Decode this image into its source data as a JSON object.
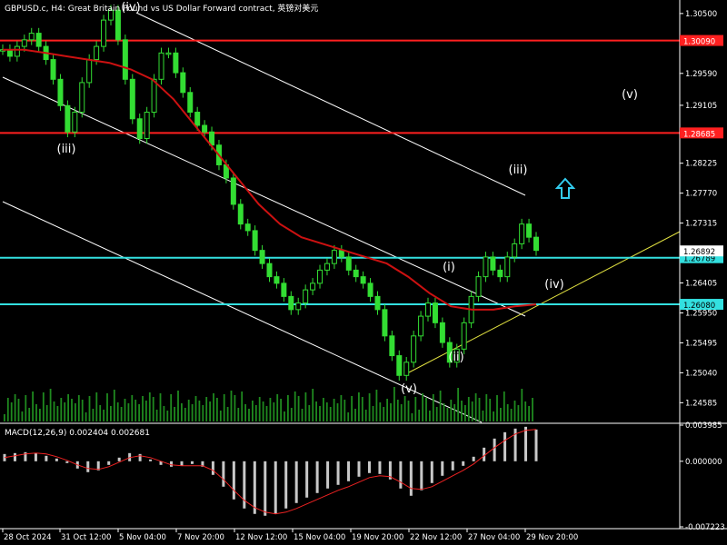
{
  "header": {
    "title": "GBPUSD.c, H4:  Great Britain Pound vs US Dollar Forward contract, 英镑对美元"
  },
  "colors": {
    "bg": "#000000",
    "candle": "#33dd33",
    "price_axis": "#ffffff",
    "support": "#ff2020",
    "cyan": "#33e0e0",
    "ma": "#cc1111",
    "channel": "#ffffff",
    "trend": "#e0e040",
    "macd_hist": "#c8c8c8",
    "signal": "#ee2222",
    "arrow": "#33ccee"
  },
  "icons": {
    "arrow": "up-arrow-icon"
  },
  "chart_data": [
    {
      "type": "line",
      "title": "GBPUSD.c, H4:  Great Britain Pound vs US Dollar Forward contract, 英镑对美元",
      "ylim": [
        1.243,
        1.3065
      ],
      "y_ticks": [
        "1.30500",
        "1.29590",
        "1.29105",
        "1.28225",
        "1.27770",
        "1.27315",
        "1.26405",
        "1.25950",
        "1.25495",
        "1.25040",
        "1.24585"
      ],
      "x_ticks": [
        "28 Oct 2024",
        "31 Oct 12:00",
        "5 Nov 04:00",
        "7 Nov 20:00",
        "12 Nov 12:00",
        "15 Nov 04:00",
        "19 Nov 20:00",
        "22 Nov 12:00",
        "27 Nov 04:00",
        "29 Nov 20:00"
      ],
      "horizontal_levels": [
        {
          "value": 1.3009,
          "label": "1.30090",
          "color": "#ff2020"
        },
        {
          "value": 1.28685,
          "label": "1.28685",
          "color": "#ff2020"
        },
        {
          "value": 1.26789,
          "label": "1.26789",
          "color": "#33e0e0"
        },
        {
          "value": 1.2608,
          "label": "1.26080",
          "color": "#33e0e0"
        }
      ],
      "current_price": "1.26892",
      "wave_labels": [
        "(iii)",
        "(iv)",
        "(v)",
        "(i)",
        "(ii)",
        "(iii)",
        "(iv)",
        "(v)"
      ],
      "price_series": [
        1.2995,
        1.2985,
        1.3,
        1.301,
        1.302,
        1.3,
        1.298,
        1.295,
        1.291,
        1.287,
        1.29,
        1.2945,
        1.298,
        1.3,
        1.304,
        1.3055,
        1.301,
        1.295,
        1.289,
        1.286,
        1.29,
        1.295,
        1.299,
        1.299,
        1.296,
        1.293,
        1.29,
        1.288,
        1.287,
        1.285,
        1.282,
        1.28,
        1.276,
        1.273,
        1.272,
        1.269,
        1.267,
        1.265,
        1.264,
        1.262,
        1.26,
        1.261,
        1.263,
        1.264,
        1.266,
        1.267,
        1.269,
        1.268,
        1.266,
        1.265,
        1.264,
        1.262,
        1.26,
        1.256,
        1.253,
        1.25,
        1.252,
        1.256,
        1.259,
        1.261,
        1.258,
        1.255,
        1.252,
        1.254,
        1.258,
        1.262,
        1.265,
        1.268,
        1.266,
        1.265,
        1.268,
        1.27,
        1.273,
        1.271,
        1.269
      ],
      "moving_average": [
        1.2995,
        1.2995,
        1.299,
        1.2985,
        1.298,
        1.2975,
        1.2965,
        1.295,
        1.292,
        1.288,
        1.284,
        1.28,
        1.276,
        1.273,
        1.271,
        1.27,
        1.269,
        1.268,
        1.267,
        1.265,
        1.2625,
        1.2605,
        1.26,
        1.26,
        1.2605,
        1.2608
      ],
      "channels": [
        "upper",
        "middle",
        "lower"
      ]
    },
    {
      "type": "bar",
      "title": "MACD(12,26,9) 0.002404 0.002681",
      "ylim": [
        -0.007223,
        0.003985
      ],
      "y_ticks": [
        "0.003985",
        "0.000000",
        "-0.007223"
      ],
      "histogram": [
        0.0008,
        0.0009,
        0.001,
        0.0009,
        0.0006,
        0.0003,
        -0.0002,
        -0.0008,
        -0.0012,
        -0.001,
        -0.0004,
        0.0004,
        0.0009,
        0.0008,
        0.0002,
        -0.0004,
        -0.0006,
        -0.0005,
        -0.0003,
        -0.0006,
        -0.0015,
        -0.0028,
        -0.0042,
        -0.0052,
        -0.0058,
        -0.006,
        -0.0058,
        -0.0052,
        -0.0046,
        -0.004,
        -0.0035,
        -0.003,
        -0.0026,
        -0.0022,
        -0.0017,
        -0.0013,
        -0.0014,
        -0.002,
        -0.003,
        -0.0038,
        -0.0032,
        -0.0024,
        -0.0016,
        -0.001,
        -0.0005,
        0.0005,
        0.0015,
        0.0025,
        0.0032,
        0.0036,
        0.0038,
        0.0035
      ],
      "signal": [
        0.0004,
        0.0006,
        0.0008,
        0.0009,
        0.0008,
        0.0005,
        0.0001,
        -0.0004,
        -0.0008,
        -0.0009,
        -0.0006,
        -0.0001,
        0.0004,
        0.0006,
        0.0004,
        0.0,
        -0.0004,
        -0.0005,
        -0.0005,
        -0.0005,
        -0.001,
        -0.002,
        -0.0032,
        -0.0043,
        -0.0051,
        -0.0056,
        -0.0058,
        -0.0056,
        -0.0052,
        -0.0047,
        -0.0042,
        -0.0037,
        -0.0032,
        -0.0028,
        -0.0023,
        -0.0018,
        -0.0016,
        -0.0017,
        -0.0023,
        -0.003,
        -0.0031,
        -0.0028,
        -0.0022,
        -0.0016,
        -0.001,
        -0.0003,
        0.0006,
        0.0015,
        0.0023,
        0.003,
        0.0034,
        0.0035
      ],
      "macd_value": "0.002404",
      "signal_value": "0.002681"
    }
  ]
}
